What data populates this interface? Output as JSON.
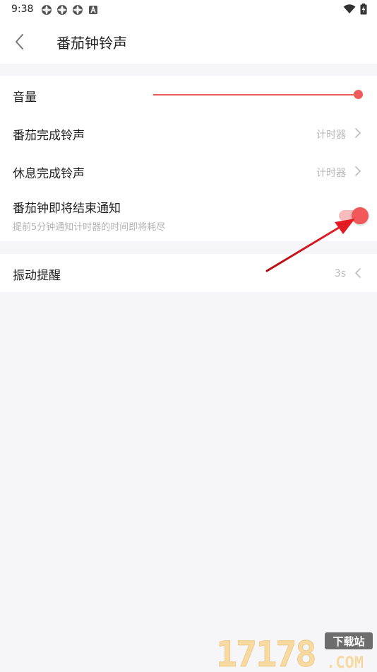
{
  "status_bar": {
    "time": "9:38",
    "left_icons": [
      "notification-pinwheel-icon",
      "notification-pinwheel-icon",
      "notification-pinwheel-icon",
      "notification-a-icon"
    ],
    "right_icons": [
      "wifi-icon",
      "battery-charging-icon"
    ]
  },
  "toolbar": {
    "back_icon": "chevron-left-icon",
    "title": "番茄钟铃声"
  },
  "settings": {
    "volume": {
      "label": "音量",
      "level": 1.0
    },
    "pomodoro_done_sound": {
      "label": "番茄完成铃声",
      "value": "计时器"
    },
    "break_done_sound": {
      "label": "休息完成铃声",
      "value": "计时器"
    },
    "ending_notice": {
      "label": "番茄钟即将结束通知",
      "sublabel": "提前5分钟通知计时器的时间即将耗尽",
      "enabled": true
    },
    "vibration": {
      "label": "振动提醒",
      "value": "3s"
    }
  },
  "colors": {
    "accent": "#f2585a",
    "accent_light": "#f7bcbc",
    "annotation_arrow": "#d9141a",
    "background": "#f6f6f8"
  },
  "watermark": {
    "text": "17178",
    "badge": "下载站",
    "domain": ".COM"
  }
}
